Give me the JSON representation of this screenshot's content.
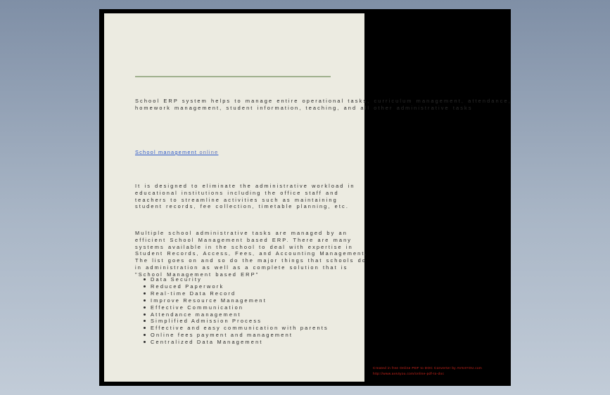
{
  "document": {
    "paragraph_1": "School ERP system helps to manage entire operational tasks, curriculum management, attendance, homework management, student information, teaching, and all other administrative tasks",
    "link_text": "School management",
    "link_suffix": "online",
    "paragraph_2": "It is designed to eliminate the administrative workload in educational institutions including the office staff and teachers to streamline activities such as maintaining student records, fee collection, timetable planning, etc.",
    "paragraph_3": "Multiple school administrative tasks are managed by an efficient School Management based ERP. There are many systems available in the school to deal with expertise in Student Records, Access, Fees, and Accounting Management. The list goes on and so do the major things that schools do in administration as well as a complete solution that is \"School Management based ERP\"",
    "benefits": [
      "Data Security",
      "Reduced Paperwork",
      "Real-time Data Record",
      "Improve Resource Management",
      "Effective Communication",
      "Attendance management",
      "Simplified Admission Process",
      "Effective and easy communication with parents",
      "Online fees payment and management",
      "Centralized Data Management"
    ]
  },
  "credit": {
    "line_1": "Created in free Online PDF to DOC Converter by AVS4YOU.com",
    "line_2": "http://www.avs4you.com/online-pdf-to-doc"
  }
}
